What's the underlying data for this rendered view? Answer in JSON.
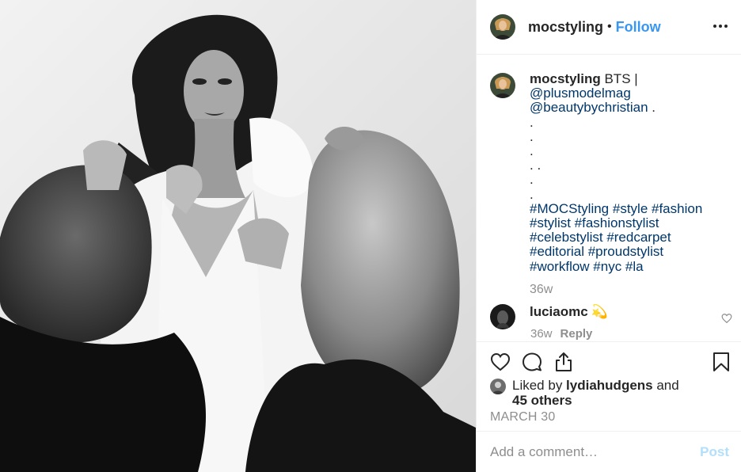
{
  "post": {
    "username": "mocstyling",
    "separator": "•",
    "follow_label": "Follow",
    "more_icon": "more-horizontal-icon"
  },
  "caption": {
    "username": "mocstyling",
    "text_1": " BTS | ",
    "mention_1": "@plusmodelmag",
    "mention_2": "@beautybychristian",
    "text_2": " .",
    "dots": [
      ".",
      ".",
      ".",
      ". .",
      ".",
      "."
    ],
    "hashtag_lines": [
      "#MOCStyling #style #fashion",
      "#stylist #fashionstylist",
      "#celebstylist #redcarpet",
      "#editorial #proudstylist",
      "#workflow #nyc #la"
    ],
    "time": "36w"
  },
  "comment": {
    "username": "luciaomc",
    "emoji": "💫",
    "time": "36w",
    "reply_label": "Reply",
    "like_icon": "heart-outline-icon"
  },
  "actions": {
    "like_icon": "heart-outline-icon",
    "comment_icon": "speech-bubble-icon",
    "share_icon": "share-upload-icon",
    "save_icon": "bookmark-icon"
  },
  "likes": {
    "prefix": "Liked by ",
    "user": "lydiahudgens",
    "and": " and",
    "others": "45 others"
  },
  "date": "MARCH 30",
  "add_comment": {
    "placeholder": "Add a comment…",
    "post_label": "Post"
  },
  "colors": {
    "link": "#00376b",
    "follow": "#3897f0",
    "muted": "#8e8e8e",
    "post_disabled": "#b2dffc",
    "border": "#efefef"
  }
}
